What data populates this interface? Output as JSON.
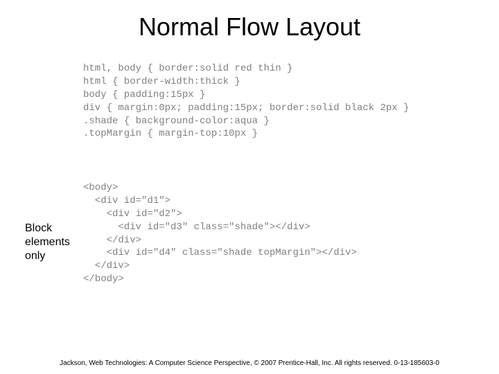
{
  "title": "Normal Flow Layout",
  "code_css": {
    "line1": "html, body { border:solid red thin }",
    "line2": "html { border-width:thick }",
    "line3": "body { padding:15px }",
    "line4": "div { margin:0px; padding:15px; border:solid black 2px }",
    "line5": ".shade { background-color:aqua }",
    "line6": ".topMargin { margin-top:10px }"
  },
  "code_html": {
    "line1": "<body>",
    "line2": "  <div id=\"d1\">",
    "line3": "    <div id=\"d2\">",
    "line4": "      <div id=\"d3\" class=\"shade\"></div>",
    "line5": "    </div>",
    "line6": "    <div id=\"d4\" class=\"shade topMargin\"></div>",
    "line7": "  </div>",
    "line8": "</body>"
  },
  "side_label": {
    "line1": "Block",
    "line2": "elements",
    "line3": "only"
  },
  "footer": "Jackson, Web Technologies: A Computer Science Perspective, © 2007 Prentice-Hall, Inc. All rights reserved. 0-13-185603-0"
}
